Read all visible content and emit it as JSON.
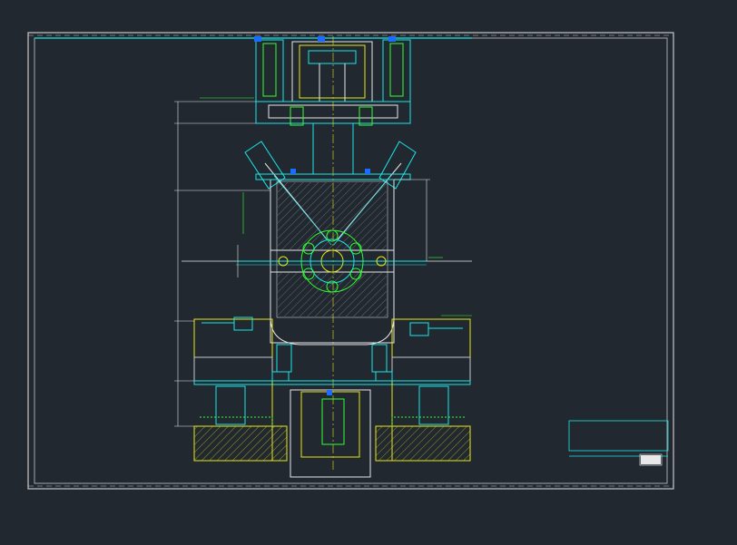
{
  "drawing": {
    "title_block_stamp": "",
    "corner_note": ""
  },
  "colors": {
    "background": "#212830",
    "border": "#c8c8c8",
    "cyan": "#19e6e6",
    "white": "#e6e6e6",
    "yellow": "#e6e619",
    "green": "#32ff32",
    "blue": "#1a6cff"
  }
}
